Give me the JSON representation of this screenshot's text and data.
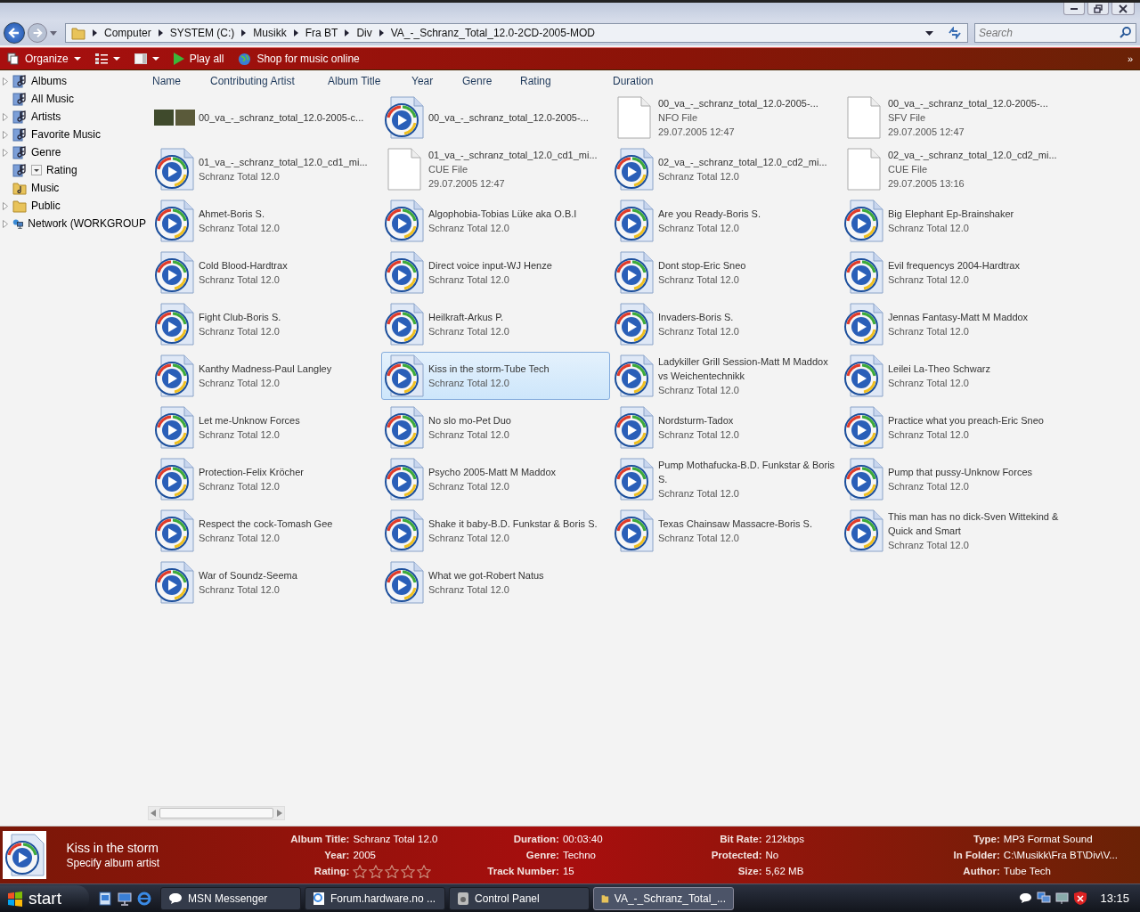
{
  "window": {
    "controls": [
      {
        "kind": "minimize"
      },
      {
        "kind": "maximize"
      },
      {
        "kind": "close"
      }
    ]
  },
  "address_bar": {
    "breadcrumbs": [
      "Computer",
      "SYSTEM (C:)",
      "Musikk",
      "Fra BT",
      "Div",
      "VA_-_Schranz_Total_12.0-2CD-2005-MOD"
    ]
  },
  "search": {
    "placeholder": "Search"
  },
  "toolbar": {
    "items": [
      {
        "kind": "organize",
        "label": "Organize"
      },
      {
        "kind": "views"
      },
      {
        "kind": "pane"
      },
      {
        "kind": "play",
        "label": "Play all"
      },
      {
        "kind": "shop",
        "label": "Shop for music online"
      }
    ],
    "overflow": "»"
  },
  "sidebar": {
    "items": [
      {
        "label": "Albums",
        "kind": "library",
        "expandable": true
      },
      {
        "label": "All Music",
        "kind": "library",
        "expandable": false
      },
      {
        "label": "Artists",
        "kind": "library",
        "expandable": true
      },
      {
        "label": "Favorite Music",
        "kind": "library",
        "expandable": true
      },
      {
        "label": "Genre",
        "kind": "library",
        "expandable": true
      },
      {
        "label": "Rating",
        "kind": "library",
        "expandable": false,
        "dropdown": true
      },
      {
        "label": "Music",
        "kind": "music-folder",
        "expandable": false
      },
      {
        "label": "Public",
        "kind": "folder",
        "expandable": true
      },
      {
        "label": "Network (WORKGROUP",
        "kind": "network",
        "expandable": true
      }
    ]
  },
  "columns": [
    "Name",
    "Contributing Artist",
    "Album Title",
    "Year",
    "Genre",
    "Rating",
    "Duration"
  ],
  "files": [
    {
      "kind": "image",
      "selected": false,
      "lines": [
        "00_va_-_schranz_total_12.0-2005-c..."
      ]
    },
    {
      "kind": "audio",
      "selected": false,
      "lines": [
        "00_va_-_schranz_total_12.0-2005-..."
      ]
    },
    {
      "kind": "document",
      "selected": false,
      "lines": [
        "00_va_-_schranz_total_12.0-2005-...",
        "NFO File",
        "29.07.2005 12:47"
      ]
    },
    {
      "kind": "document",
      "selected": false,
      "lines": [
        "00_va_-_schranz_total_12.0-2005-...",
        "SFV File",
        "29.07.2005 12:47"
      ]
    },
    {
      "kind": "audio",
      "selected": false,
      "lines": [
        "01_va_-_schranz_total_12.0_cd1_mi...",
        "Schranz Total 12.0"
      ]
    },
    {
      "kind": "document",
      "selected": false,
      "lines": [
        "01_va_-_schranz_total_12.0_cd1_mi...",
        "CUE File",
        "29.07.2005 12:47"
      ]
    },
    {
      "kind": "audio",
      "selected": false,
      "lines": [
        "02_va_-_schranz_total_12.0_cd2_mi...",
        "Schranz Total 12.0"
      ]
    },
    {
      "kind": "document",
      "selected": false,
      "lines": [
        "02_va_-_schranz_total_12.0_cd2_mi...",
        "CUE File",
        "29.07.2005 13:16"
      ]
    },
    {
      "kind": "audio",
      "selected": false,
      "lines": [
        "Ahmet-Boris S.",
        "Schranz Total 12.0"
      ]
    },
    {
      "kind": "audio",
      "selected": false,
      "lines": [
        "Algophobia-Tobias Lüke aka O.B.I",
        "Schranz Total 12.0"
      ]
    },
    {
      "kind": "audio",
      "selected": false,
      "lines": [
        "Are you Ready-Boris S.",
        "Schranz Total 12.0"
      ]
    },
    {
      "kind": "audio",
      "selected": false,
      "lines": [
        "Big Elephant Ep-Brainshaker",
        "Schranz Total 12.0"
      ]
    },
    {
      "kind": "audio",
      "selected": false,
      "lines": [
        "Cold Blood-Hardtrax",
        "Schranz Total 12.0"
      ]
    },
    {
      "kind": "audio",
      "selected": false,
      "lines": [
        "Direct voice input-WJ Henze",
        "Schranz Total 12.0"
      ]
    },
    {
      "kind": "audio",
      "selected": false,
      "lines": [
        "Dont stop-Eric Sneo",
        "Schranz Total 12.0"
      ]
    },
    {
      "kind": "audio",
      "selected": false,
      "lines": [
        "Evil frequencys 2004-Hardtrax",
        "Schranz Total 12.0"
      ]
    },
    {
      "kind": "audio",
      "selected": false,
      "lines": [
        "Fight Club-Boris S.",
        "Schranz Total 12.0"
      ]
    },
    {
      "kind": "audio",
      "selected": false,
      "lines": [
        "Heilkraft-Arkus P.",
        "Schranz Total 12.0"
      ]
    },
    {
      "kind": "audio",
      "selected": false,
      "lines": [
        "Invaders-Boris S.",
        "Schranz Total 12.0"
      ]
    },
    {
      "kind": "audio",
      "selected": false,
      "lines": [
        "Jennas Fantasy-Matt M Maddox",
        "Schranz Total 12.0"
      ]
    },
    {
      "kind": "audio",
      "selected": false,
      "lines": [
        "Kanthy Madness-Paul Langley",
        "Schranz Total 12.0"
      ]
    },
    {
      "kind": "audio",
      "selected": true,
      "lines": [
        "Kiss in the storm-Tube Tech",
        "Schranz Total 12.0"
      ]
    },
    {
      "kind": "audio",
      "selected": false,
      "lines": [
        "Ladykiller Grill Session-Matt M Maddox vs Weichentechnikk",
        "Schranz Total 12.0"
      ]
    },
    {
      "kind": "audio",
      "selected": false,
      "lines": [
        "Leilei La-Theo Schwarz",
        "Schranz Total 12.0"
      ]
    },
    {
      "kind": "audio",
      "selected": false,
      "lines": [
        "Let me-Unknow Forces",
        "Schranz Total 12.0"
      ]
    },
    {
      "kind": "audio",
      "selected": false,
      "lines": [
        "No slo mo-Pet Duo",
        "Schranz Total 12.0"
      ]
    },
    {
      "kind": "audio",
      "selected": false,
      "lines": [
        "Nordsturm-Tadox",
        "Schranz Total 12.0"
      ]
    },
    {
      "kind": "audio",
      "selected": false,
      "lines": [
        "Practice what you preach-Eric Sneo",
        "Schranz Total 12.0"
      ]
    },
    {
      "kind": "audio",
      "selected": false,
      "lines": [
        "Protection-Felix Kröcher",
        "Schranz Total 12.0"
      ]
    },
    {
      "kind": "audio",
      "selected": false,
      "lines": [
        "Psycho 2005-Matt M Maddox",
        "Schranz Total 12.0"
      ]
    },
    {
      "kind": "audio",
      "selected": false,
      "lines": [
        "Pump Mothafucka-B.D. Funkstar & Boris S.",
        "Schranz Total 12.0"
      ]
    },
    {
      "kind": "audio",
      "selected": false,
      "lines": [
        "Pump that pussy-Unknow Forces",
        "Schranz Total 12.0"
      ]
    },
    {
      "kind": "audio",
      "selected": false,
      "lines": [
        "Respect the cock-Tomash Gee",
        "Schranz Total 12.0"
      ]
    },
    {
      "kind": "audio",
      "selected": false,
      "lines": [
        "Shake it baby-B.D. Funkstar & Boris S.",
        "Schranz Total 12.0"
      ]
    },
    {
      "kind": "audio",
      "selected": false,
      "lines": [
        "Texas Chainsaw Massacre-Boris S.",
        "Schranz Total 12.0"
      ]
    },
    {
      "kind": "audio",
      "selected": false,
      "lines": [
        "This man has no dick-Sven Wittekind & Quick and Smart",
        "Schranz Total 12.0"
      ]
    },
    {
      "kind": "audio",
      "selected": false,
      "lines": [
        "War of Soundz-Seema",
        "Schranz Total 12.0"
      ]
    },
    {
      "kind": "audio",
      "selected": false,
      "lines": [
        "What we got-Robert Natus",
        "Schranz Total 12.0"
      ]
    }
  ],
  "details": {
    "title": "Kiss in the storm",
    "subtitle": "Specify album artist",
    "groups": [
      [
        {
          "label": "Album Title:",
          "value": "Schranz Total 12.0"
        },
        {
          "label": "Year:",
          "value": "2005"
        },
        {
          "label": "Rating:",
          "kind": "stars",
          "stars": 0
        }
      ],
      [
        {
          "label": "Duration:",
          "value": "00:03:40"
        },
        {
          "label": "Genre:",
          "value": "Techno"
        },
        {
          "label": "Track Number:",
          "value": "15"
        }
      ],
      [
        {
          "label": "Bit Rate:",
          "value": "212kbps"
        },
        {
          "label": "Protected:",
          "value": "No"
        },
        {
          "label": "Size:",
          "value": "5,62 MB"
        }
      ],
      [
        {
          "label": "Type:",
          "value": "MP3 Format Sound"
        },
        {
          "label": "In Folder:",
          "value": "C:\\Musikk\\Fra BT\\Div\\V..."
        },
        {
          "label": "Author:",
          "value": "Tube Tech"
        }
      ]
    ]
  },
  "taskbar": {
    "start": "start",
    "quick_launch": [
      {
        "kind": "desktop-switch"
      },
      {
        "kind": "show-desktop"
      },
      {
        "kind": "browser"
      }
    ],
    "tasks": [
      {
        "label": "MSN Messenger",
        "kind": "chat",
        "selected": false
      },
      {
        "label": "Forum.hardware.no ...",
        "kind": "browser",
        "selected": false
      },
      {
        "label": "Control Panel",
        "kind": "panel",
        "selected": false
      },
      {
        "label": "VA_-_Schranz_Total_...",
        "kind": "folder",
        "selected": true
      }
    ],
    "clock": "13:15"
  }
}
